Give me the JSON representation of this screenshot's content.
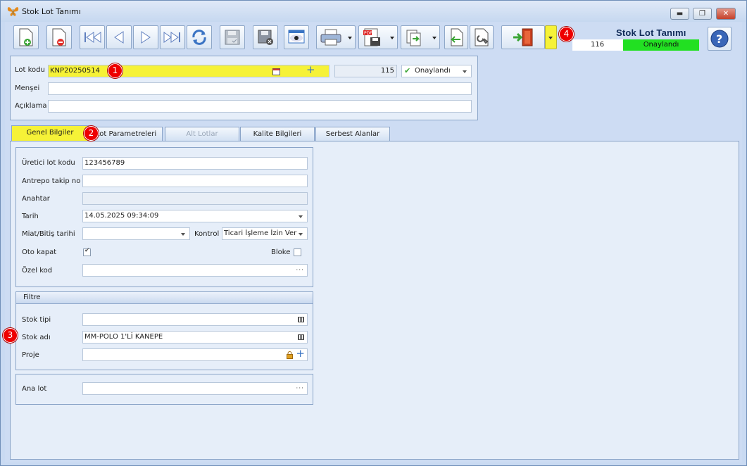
{
  "window": {
    "title": "Stok Lot Tanımı",
    "min_label": "▬",
    "max_label": "❐",
    "close_label": "✕"
  },
  "header": {
    "form_title": "Stok Lot Tanımı",
    "record_no": "116",
    "status": "Onaylandı"
  },
  "toolbar": {
    "buttons": [
      "new-icon",
      "delete-icon",
      "first-icon",
      "previous-icon",
      "next-icon",
      "last-icon",
      "refresh-icon",
      "save-icon",
      "save-cancel-icon",
      "preview-icon",
      "print-icon",
      "pdf-icon",
      "export-icon",
      "import-icon",
      "tools-icon",
      "exit-icon"
    ]
  },
  "lot": {
    "code_label": "Lot kodu",
    "code_value": "KNP20250514",
    "number": "115",
    "status": "Onaylandı",
    "origin_label": "Menşei",
    "origin_value": "",
    "desc_label": "Açıklama",
    "desc_value": ""
  },
  "tabs": [
    "Genel Bilgiler",
    "Lot Parametreleri",
    "Alt Lotlar",
    "Kalite Bilgileri",
    "Serbest Alanlar"
  ],
  "general": {
    "producer_lot_label": "Üretici lot kodu",
    "producer_lot_value": "123456789",
    "antrepo_label": "Antrepo takip no",
    "antrepo_value": "",
    "key_label": "Anahtar",
    "key_value": "",
    "date_label": "Tarih",
    "date_value": "14.05.2025 09:34:09",
    "expiry_label": "Miat/Bitiş tarihi",
    "expiry_value": "",
    "control_label": "Kontrol",
    "control_value": "Ticari İşleme İzin Ver",
    "auto_close_label": "Oto kapat",
    "auto_close_checked": true,
    "block_label": "Bloke",
    "block_checked": false,
    "special_code_label": "Özel kod",
    "special_code_value": "",
    "ellipsis": "···"
  },
  "filter": {
    "title": "Filtre",
    "stock_type_label": "Stok tipi",
    "stock_type_value": "",
    "stock_name_label": "Stok adı",
    "stock_name_value": "MM-POLO 1'Lİ KANEPE",
    "project_label": "Proje",
    "project_value": ""
  },
  "parent": {
    "label": "Ana lot",
    "value": ""
  },
  "badges": [
    "1",
    "2",
    "3",
    "4"
  ],
  "colors": {
    "highlight": "#f6f237",
    "status_green": "#22e022",
    "badge_red": "#e00000",
    "panel": "#e6eef9"
  }
}
